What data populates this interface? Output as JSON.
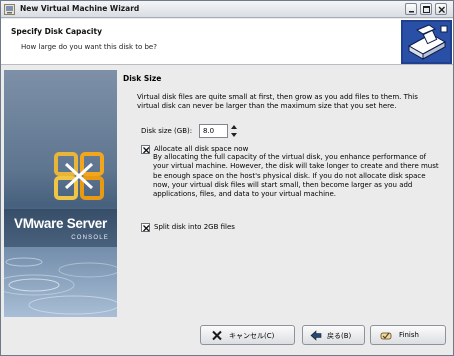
{
  "window": {
    "title": "New Virtual Machine Wizard"
  },
  "header": {
    "title": "Specify Disk Capacity",
    "subtitle": "How large do you want this disk to be?"
  },
  "banner": {
    "product": "VMware Server",
    "edition": "CONSOLE"
  },
  "disk_size": {
    "section_title": "Disk Size",
    "description": "Virtual disk files are quite small at first, then grow as you add files to them. This virtual disk can never be larger than the maximum size that you set here.",
    "size_label": "Disk size (GB):",
    "size_value": "8.0",
    "allocate_label": "Allocate all disk space now",
    "allocate_checked": true,
    "allocate_description": "By allocating the full capacity of the virtual disk, you enhance performance of your virtual machine. However, the disk will take longer to create and there must be enough space on the host's physical disk. If you do not allocate disk space now, your virtual disk files will start small, then become larger as you add applications, files, and data to your virtual machine.",
    "split_label": "Split disk into 2GB files",
    "split_checked": true
  },
  "buttons": {
    "cancel": "キャンセル(C)",
    "back": "戻る(B)",
    "finish": "Finish"
  },
  "icons": {
    "titlebar": "vm-wizard-icon",
    "header": "disk-drive-icon",
    "cancel": "cross-icon",
    "back": "back-arrow-icon",
    "finish": "finish-icon"
  }
}
